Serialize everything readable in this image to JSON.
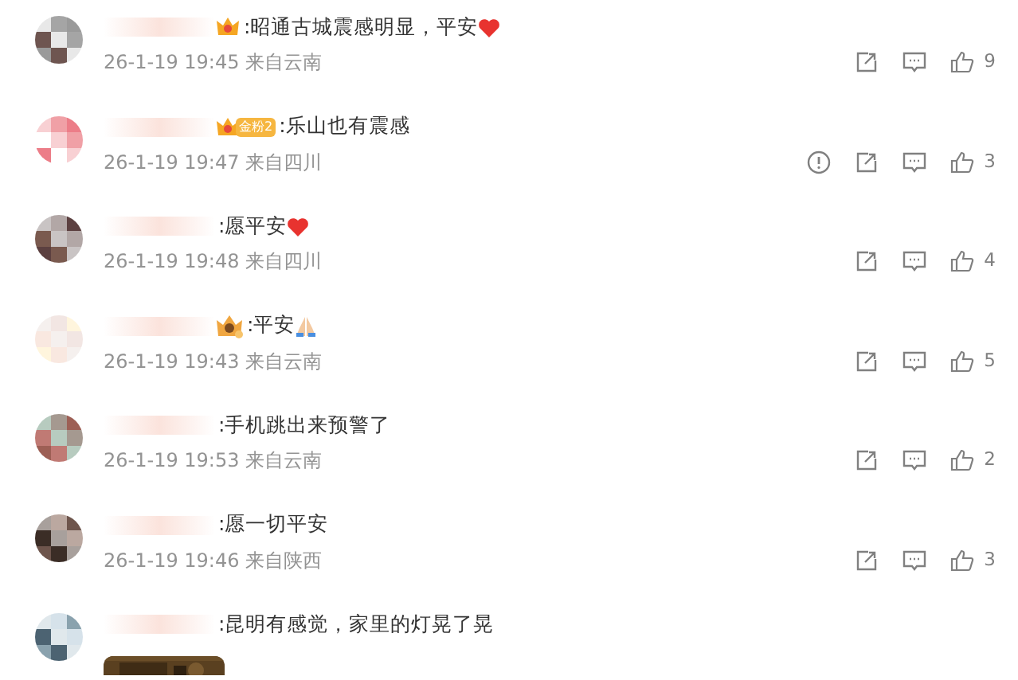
{
  "comments": [
    {
      "badge": {
        "kind": "crown"
      },
      "text": ":昭通古城震感明显，平安",
      "trailing_icon": {
        "kind": "heart"
      },
      "time": "26-1-19 19:45",
      "location": "来自云南",
      "reportable": false,
      "likes": "9"
    },
    {
      "badge": {
        "kind": "fan",
        "label": "金粉2"
      },
      "text": ":乐山也有震感",
      "time": "26-1-19 19:47",
      "location": "来自四川",
      "reportable": true,
      "likes": "3"
    },
    {
      "text": ":愿平安",
      "trailing_icon": {
        "kind": "heart"
      },
      "time": "26-1-19 19:48",
      "location": "来自四川",
      "reportable": false,
      "likes": "4"
    },
    {
      "badge": {
        "kind": "medal"
      },
      "text": ":平安",
      "trailing_icon": {
        "kind": "pray"
      },
      "time": "26-1-19 19:43",
      "location": "来自云南",
      "reportable": false,
      "likes": "5"
    },
    {
      "text": ":手机跳出来预警了",
      "time": "26-1-19 19:53",
      "location": "来自云南",
      "reportable": false,
      "likes": "2"
    },
    {
      "text": ":愿一切平安",
      "time": "26-1-19 19:46",
      "location": "来自陕西",
      "reportable": false,
      "likes": "3"
    },
    {
      "text": ":昆明有感觉，家里的灯晃了晃"
    }
  ]
}
